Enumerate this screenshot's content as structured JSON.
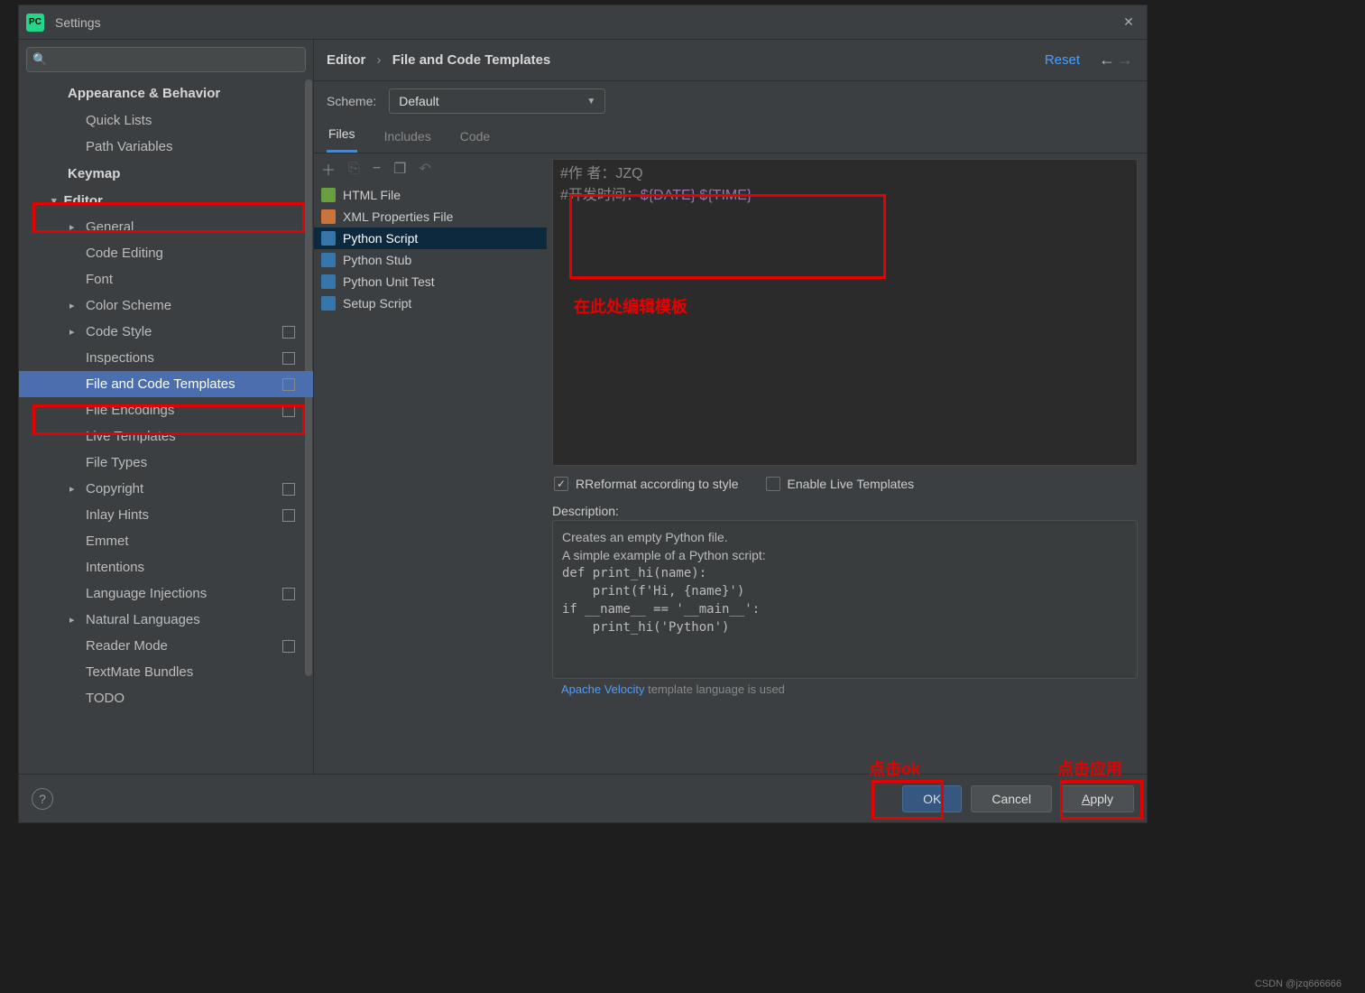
{
  "title": "Settings",
  "breadcrumb": {
    "a": "Editor",
    "b": "File and Code Templates"
  },
  "reset": "Reset",
  "scheme": {
    "label": "Scheme:",
    "value": "Default"
  },
  "tabs": [
    "Files",
    "Includes",
    "Code"
  ],
  "sidebar": {
    "top": [
      {
        "label": "Appearance & Behavior",
        "type": "cat"
      },
      {
        "label": "Quick Lists",
        "type": "item"
      },
      {
        "label": "Path Variables",
        "type": "item"
      },
      {
        "label": "Keymap",
        "type": "cat2"
      },
      {
        "label": "Editor",
        "type": "cat-exp"
      },
      {
        "label": "General",
        "type": "arrow"
      },
      {
        "label": "Code Editing",
        "type": "item"
      },
      {
        "label": "Font",
        "type": "item"
      },
      {
        "label": "Color Scheme",
        "type": "arrow"
      },
      {
        "label": "Code Style",
        "type": "arrow",
        "proj": true
      },
      {
        "label": "Inspections",
        "type": "item",
        "proj": true
      },
      {
        "label": "File and Code Templates",
        "type": "sel",
        "proj": true
      },
      {
        "label": "File Encodings",
        "type": "item",
        "proj": true
      },
      {
        "label": "Live Templates",
        "type": "item"
      },
      {
        "label": "File Types",
        "type": "item"
      },
      {
        "label": "Copyright",
        "type": "arrow",
        "proj": true
      },
      {
        "label": "Inlay Hints",
        "type": "item",
        "proj": true
      },
      {
        "label": "Emmet",
        "type": "item"
      },
      {
        "label": "Intentions",
        "type": "item"
      },
      {
        "label": "Language Injections",
        "type": "item",
        "proj": true
      },
      {
        "label": "Natural Languages",
        "type": "arrow"
      },
      {
        "label": "Reader Mode",
        "type": "item",
        "proj": true
      },
      {
        "label": "TextMate Bundles",
        "type": "item"
      },
      {
        "label": "TODO",
        "type": "item"
      }
    ]
  },
  "files": [
    {
      "name": "HTML File",
      "icon": "html"
    },
    {
      "name": "XML Properties File",
      "icon": "xml"
    },
    {
      "name": "Python Script",
      "icon": "py",
      "sel": true
    },
    {
      "name": "Python Stub",
      "icon": "py"
    },
    {
      "name": "Python Unit Test",
      "icon": "py"
    },
    {
      "name": "Setup Script",
      "icon": "py"
    }
  ],
  "template": {
    "line1_prefix": "#作    者：",
    "line1_value": "JZQ",
    "line2_prefix": "#开发时间：",
    "line2_var": "${DATE} ${TIME}"
  },
  "annotations": {
    "edit_here": "在此处编辑模板",
    "click_ok": "点击ok",
    "click_apply": "点击应用"
  },
  "reformat": "Reformat according to style",
  "enable_live": "Enable Live Templates",
  "desc_label": "Description:",
  "description": {
    "l1": "Creates an empty Python file.",
    "l2": "A simple example of a Python script:",
    "l3": "def print_hi(name):",
    "l4": "    print(f'Hi, {name}')",
    "l5": "",
    "l6": "",
    "l7": "if __name__ == '__main__':",
    "l8": "    print_hi('Python')"
  },
  "velocity": {
    "link": "Apache Velocity",
    "text": " template language is used"
  },
  "buttons": {
    "ok": "OK",
    "cancel": "Cancel",
    "apply": "Apply"
  },
  "watermark": "CSDN @jzq666666"
}
